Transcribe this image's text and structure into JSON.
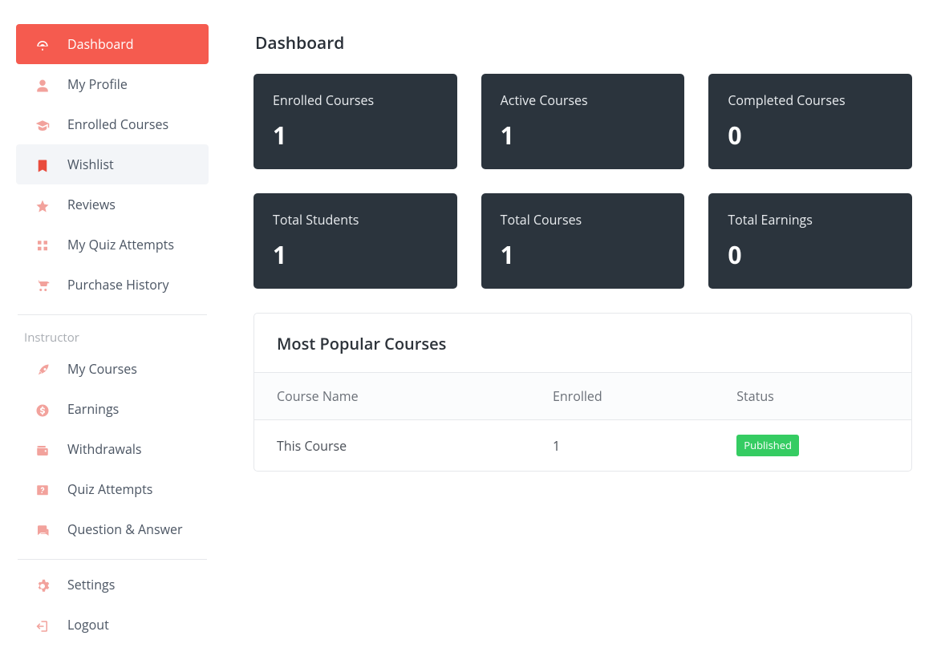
{
  "page": {
    "title": "Dashboard"
  },
  "sidebar": {
    "student": [
      {
        "label": "Dashboard",
        "icon": "dashboard-icon",
        "state": "active"
      },
      {
        "label": "My Profile",
        "icon": "user-icon",
        "state": ""
      },
      {
        "label": "Enrolled Courses",
        "icon": "graduation-icon",
        "state": ""
      },
      {
        "label": "Wishlist",
        "icon": "bookmark-icon",
        "state": "hovered"
      },
      {
        "label": "Reviews",
        "icon": "star-icon",
        "state": ""
      },
      {
        "label": "My Quiz Attempts",
        "icon": "quiz-icon",
        "state": ""
      },
      {
        "label": "Purchase History",
        "icon": "cart-icon",
        "state": ""
      }
    ],
    "instructor_heading": "Instructor",
    "instructor": [
      {
        "label": "My Courses",
        "icon": "rocket-icon"
      },
      {
        "label": "Earnings",
        "icon": "dollar-icon"
      },
      {
        "label": "Withdrawals",
        "icon": "wallet-icon"
      },
      {
        "label": "Quiz Attempts",
        "icon": "question-icon"
      },
      {
        "label": "Question & Answer",
        "icon": "qa-icon"
      }
    ],
    "footer": [
      {
        "label": "Settings",
        "icon": "gear-icon"
      },
      {
        "label": "Logout",
        "icon": "logout-icon"
      }
    ]
  },
  "stats": [
    {
      "label": "Enrolled Courses",
      "value": "1"
    },
    {
      "label": "Active Courses",
      "value": "1"
    },
    {
      "label": "Completed Courses",
      "value": "0"
    },
    {
      "label": "Total Students",
      "value": "1"
    },
    {
      "label": "Total Courses",
      "value": "1"
    },
    {
      "label": "Total Earnings",
      "value": "0"
    }
  ],
  "popular": {
    "title": "Most Popular Courses",
    "columns": [
      "Course Name",
      "Enrolled",
      "Status"
    ],
    "rows": [
      {
        "name": "This Course",
        "enrolled": "1",
        "status": "Published"
      }
    ]
  }
}
